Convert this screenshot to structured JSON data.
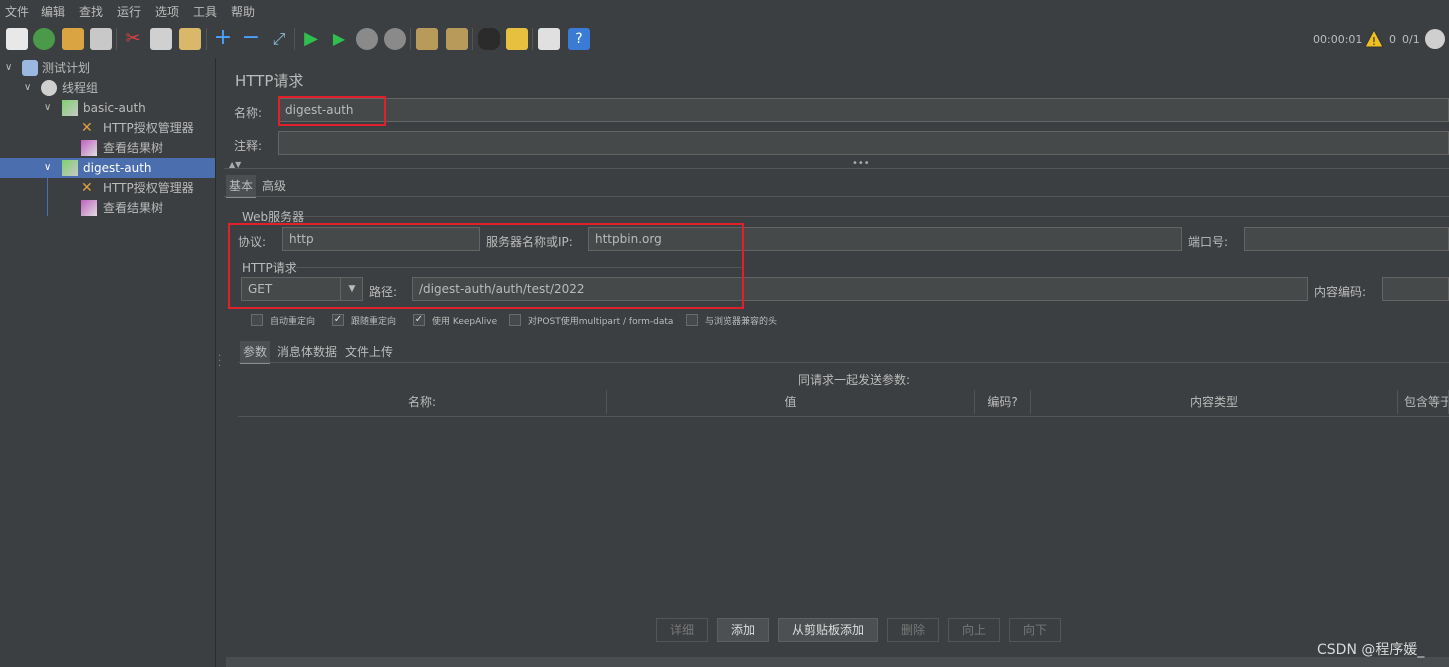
{
  "menu": [
    "文件",
    "编辑",
    "查找",
    "运行",
    "选项",
    "工具",
    "帮助"
  ],
  "status": {
    "time": "00:00:01",
    "warnings": "0",
    "threads": "0/1"
  },
  "tree": {
    "test_plan": "测试计划",
    "thread_group": "线程组",
    "basic_auth": "basic-auth",
    "basic_auth_children": [
      "HTTP授权管理器",
      "查看结果树"
    ],
    "digest_auth": "digest-auth",
    "digest_auth_children": [
      "HTTP授权管理器",
      "查看结果树"
    ]
  },
  "panel": {
    "title": "HTTP请求",
    "name_label": "名称:",
    "name_value": "digest-auth",
    "comment_label": "注释:",
    "comment_value": "",
    "tabs": [
      "基本",
      "高级"
    ],
    "web_server_section": "Web服务器",
    "protocol_label": "协议:",
    "protocol_value": "http",
    "server_label": "服务器名称或IP:",
    "server_value": "httpbin.org",
    "port_label": "端口号:",
    "port_value": "",
    "http_request_section": "HTTP请求",
    "method": "GET",
    "path_label": "路径:",
    "path_value": "/digest-auth/auth/test/2022",
    "encoding_label": "内容编码:",
    "encoding_value": "",
    "options": [
      {
        "label": "自动重定向",
        "checked": false
      },
      {
        "label": "跟随重定向",
        "checked": true
      },
      {
        "label": "使用 KeepAlive",
        "checked": true
      },
      {
        "label": "对POST使用multipart / form-data",
        "checked": false
      },
      {
        "label": "与浏览器兼容的头",
        "checked": false
      }
    ],
    "param_tabs": [
      "参数",
      "消息体数据",
      "文件上传"
    ],
    "params_caption": "同请求一起发送参数:",
    "columns": [
      "名称:",
      "值",
      "编码?",
      "内容类型",
      "包含等于"
    ],
    "buttons": {
      "detail": "详细",
      "add": "添加",
      "add_clipboard": "从剪贴板添加",
      "delete": "删除",
      "up": "向上",
      "down": "向下"
    }
  },
  "watermark": "CSDN @程序媛_"
}
